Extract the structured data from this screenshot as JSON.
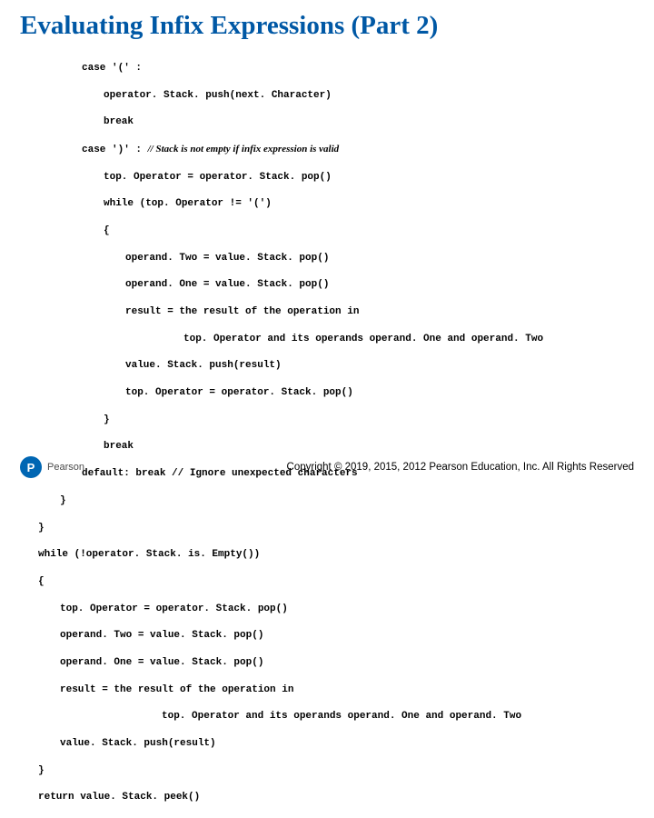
{
  "title": "Evaluating Infix Expressions (Part 2)",
  "code": {
    "l1": "case '(' :",
    "l2": "operator. Stack. push(next. Character)",
    "l3": "break",
    "l4a": "case ')' : ",
    "l4b": "// Stack is not empty if infix expression is valid",
    "l5": "top. Operator = operator. Stack. pop()",
    "l6": "while (top. Operator != '(')",
    "l7": "{",
    "l8": "operand. Two = value. Stack. pop()",
    "l9": "operand. One = value. Stack. pop()",
    "l10": "result = the result of the operation in",
    "l11": "top. Operator and its operands operand. One and operand. Two",
    "l12": "value. Stack. push(result)",
    "l13": "top. Operator = operator. Stack. pop()",
    "l14": "}",
    "l15": "break",
    "l16": "default: break // Ignore unexpected characters",
    "l17": "}",
    "l18": "}",
    "l19": "while (!operator. Stack. is. Empty())",
    "l20": "{",
    "l21": "top. Operator = operator. Stack. pop()",
    "l22": "operand. Two = value. Stack. pop()",
    "l23": "operand. One = value. Stack. pop()",
    "l24": "result = the result of the operation in",
    "l25": "top. Operator and its operands operand. One and operand. Two",
    "l26": "value. Stack. push(result)",
    "l27": "}",
    "l28": "return value. Stack. peek()"
  },
  "logo_letter": "P",
  "brand": "Pearson",
  "copyright": "Copyright © 2019, 2015, 2012 Pearson Education, Inc. All Rights Reserved"
}
